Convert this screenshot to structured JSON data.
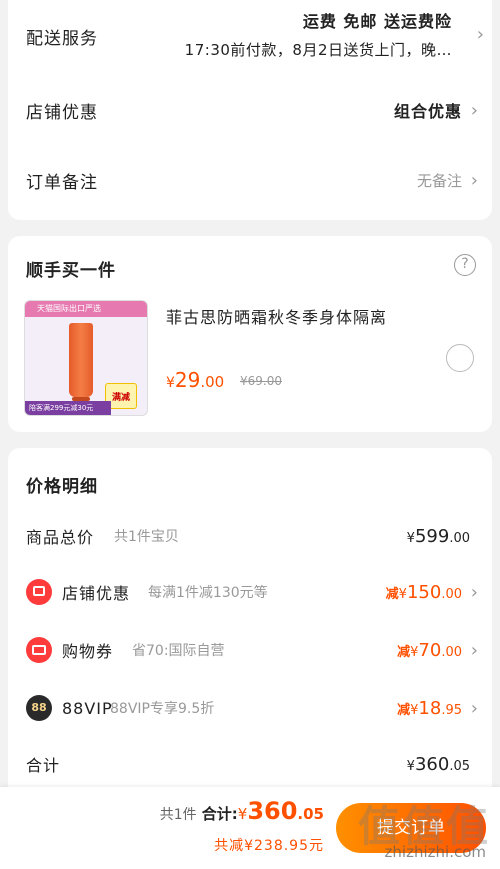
{
  "delivery": {
    "label": "配送服务",
    "line1": "运费 免邮 送运费险",
    "line2": "17:30前付款，8月2日送货上门，晚…"
  },
  "shop_discount": {
    "label": "店铺优惠",
    "value": "组合优惠"
  },
  "note": {
    "label": "订单备注",
    "value": "无备注"
  },
  "addon": {
    "title": "顺手买一件",
    "product_name": "菲古思防晒霜秋冬季身体隔离",
    "price_symbol": "¥",
    "price_int": "29",
    "price_dec": ".00",
    "original_price": "¥69.00",
    "thumb_banner": "天猫国际出口严选",
    "thumb_promo": "满减 49",
    "thumb_footer": "陪客满299元减30元"
  },
  "price_detail": {
    "title": "价格明细",
    "items": [
      {
        "label": "商品总价",
        "sub": "共1件宝贝",
        "prefix": "",
        "symbol": "¥",
        "int": "599",
        "dec": ".00",
        "chevron": false
      },
      {
        "label": "店铺优惠",
        "sub": "每满1件减130元等",
        "prefix": "减",
        "symbol": "¥",
        "int": "150",
        "dec": ".00",
        "chevron": true
      },
      {
        "label": "购物券",
        "sub": "省70:国际自营",
        "prefix": "减",
        "symbol": "¥",
        "int": "70",
        "dec": ".00",
        "chevron": true
      },
      {
        "label": "88VIP",
        "sub": "88VIP专享9.5折",
        "prefix": "减",
        "symbol": "¥",
        "int": "18",
        "dec": ".95",
        "chevron": true
      }
    ],
    "total_label": "合计",
    "total_symbol": "¥",
    "total_int": "360",
    "total_dec": ".05"
  },
  "footer": {
    "count": "共1件",
    "total_label": "合计:",
    "total_symbol": "¥",
    "total_int": "360",
    "total_dec": ".05",
    "saved": "共减¥238.95元",
    "submit": "提交订单",
    "watermark": "值值值",
    "watermark_url": "zhizhizhi.com"
  },
  "colors": {
    "accent": "#ff5000",
    "background": "#f2f2f2",
    "card": "#ffffff"
  }
}
